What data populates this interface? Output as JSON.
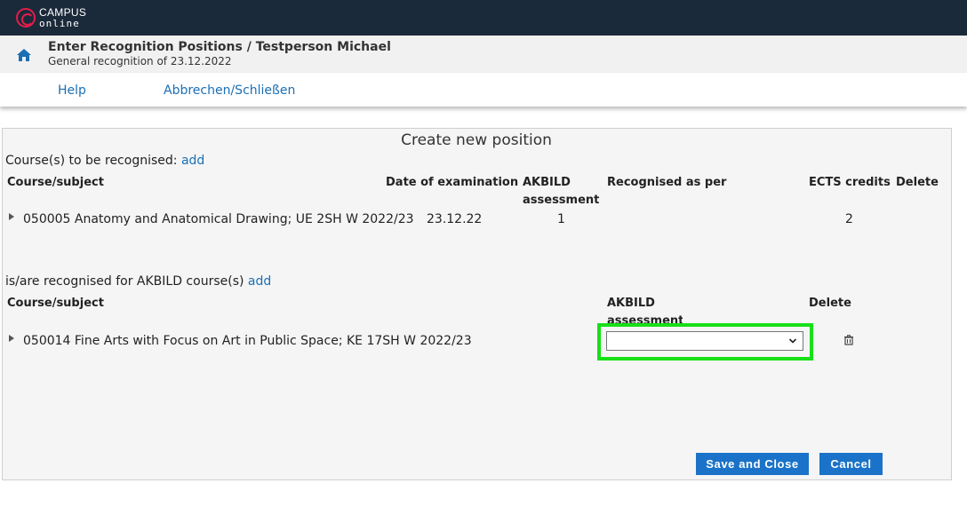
{
  "app": {
    "logo_line1": "CAMPUS",
    "logo_line2": "online",
    "brand_color": "#e21d4a",
    "topbar_color": "#1b2a3a"
  },
  "header": {
    "title": "Enter Recognition Positions  / Testperson Michael",
    "subtitle": "General recognition of 23.12.2022",
    "home_icon": "home-icon"
  },
  "menu": {
    "help": "Help",
    "abort": "Abbrechen/Schließen"
  },
  "form": {
    "title": "Create new position",
    "section1": {
      "label": "Course(s) to be recognised:",
      "add": "add",
      "columns": {
        "course": "Course/subject",
        "date": "Date of examination",
        "assessment": "AKBILD assessment",
        "recognised_as": "Recognised as per",
        "ects": "ECTS credits",
        "delete": "Delete"
      },
      "rows": [
        {
          "course": "050005 Anatomy and Anatomical Drawing; UE 2SH W 2022/23",
          "date": "23.12.22",
          "assessment": "1",
          "recognised_as": "",
          "ects": "2"
        }
      ]
    },
    "section2": {
      "label": "is/are recognised for AKBILD course(s)",
      "add": "add",
      "columns": {
        "course": "Course/subject",
        "assessment": "AKBILD assessment",
        "delete": "Delete"
      },
      "rows": [
        {
          "course": "050014 Fine Arts with Focus on Art in Public Space; KE 17SH W 2022/23",
          "assessment_selected": ""
        }
      ]
    },
    "buttons": {
      "save": "Save and Close",
      "cancel": "Cancel"
    }
  }
}
